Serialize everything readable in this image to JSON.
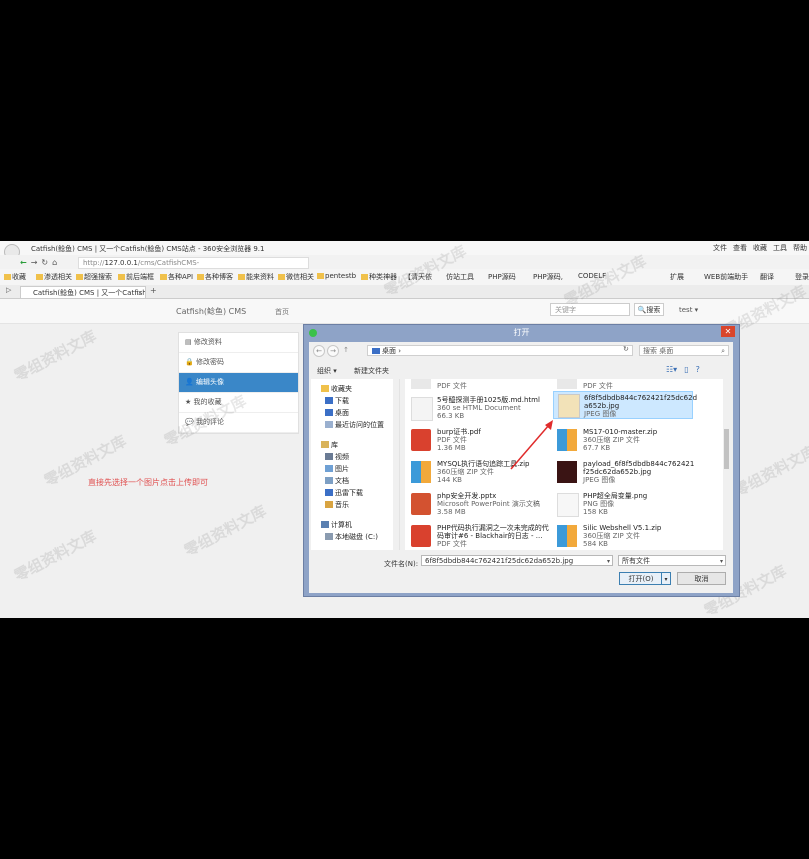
{
  "browser": {
    "window_title": "Catfish(鲶鱼) CMS | 又一个Catfish(鲶鱼) CMS站点 - 360安全浏览器 9.1",
    "menu": [
      "文件",
      "查看",
      "收藏",
      "工具",
      "帮助"
    ],
    "url_prefix": "http://",
    "url_host": "127.0.0.1",
    "url_path": "/cms/CatfishCMS-4.6.12/user/index/touxiang.html",
    "bookmarks": [
      "收藏",
      "渗透相关",
      "超强搜索",
      "前后端框",
      "各种API",
      "各种博客",
      "能来资料",
      "微信相关",
      "pentestb",
      "种类神器",
      "【清天依",
      "仿站工具",
      "PHP源码",
      "PHP源码,",
      "CODELF"
    ],
    "bookmarks_right": [
      "扩展",
      "WEB前端助手",
      "翻译",
      "登录"
    ],
    "tab_label": "Catfish(鲶鱼) CMS | 又一个Catfish",
    "tab_plus": "+"
  },
  "site": {
    "logo": "Catfish(鲶鱼) CMS",
    "home": "首页",
    "search_placeholder": "关键字",
    "search_button": "搜索",
    "user": "test",
    "sidebar": [
      "修改资料",
      "修改密码",
      "编辑头像",
      "我的收藏",
      "我的评论"
    ],
    "hint": "直接先选择一个图片点击上传即可"
  },
  "watermark": "零组资料文库",
  "dialog": {
    "title": "打开",
    "path": "桌面",
    "search_placeholder": "搜索 桌面",
    "organize": "组织",
    "new_folder": "新建文件夹",
    "tree": [
      "收藏夹",
      "下载",
      "桌面",
      "最近访问的位置",
      "库",
      "视频",
      "图片",
      "文档",
      "迅雷下载",
      "音乐",
      "计算机",
      "本地磁盘 (C:)"
    ],
    "files": [
      {
        "name": "",
        "type": "PDF 文件",
        "size": "",
        "icon": "pdf"
      },
      {
        "name": "",
        "type": "PDF 文件",
        "size": "",
        "icon": "pdf"
      },
      {
        "name": "5号醯探测手册1025版.md.html",
        "type": "360 se HTML Document",
        "size": "66.3 KB",
        "icon": "html"
      },
      {
        "name": "6f8f5dbdb844c762421f25dc62d a652b.jpg",
        "type": "JPEG 图像",
        "size": "",
        "icon": "image",
        "selected": true
      },
      {
        "name": "burp证书.pdf",
        "type": "PDF 文件",
        "size": "1.36 MB",
        "icon": "pdf"
      },
      {
        "name": "MS17-010-master.zip",
        "type": "360压缩 ZIP 文件",
        "size": "67.7 KB",
        "icon": "zip"
      },
      {
        "name": "MYSQL执行语句追踪工具.zip",
        "type": "360压缩 ZIP 文件",
        "size": "144 KB",
        "icon": "zip"
      },
      {
        "name": "payload_6f8f5dbdb844c762421 f25dc62da652b.jpg",
        "type": "JPEG 图像",
        "size": "",
        "icon": "dark"
      },
      {
        "name": "php安全开发.pptx",
        "type": "Microsoft PowerPoint 演示文稿",
        "size": "3.58 MB",
        "icon": "pptx"
      },
      {
        "name": "PHP超全局变量.png",
        "type": "PNG 图像",
        "size": "158 KB",
        "icon": "png"
      },
      {
        "name": "PHP代码执行漏洞之一次未完成的代码审计#6 - Blackhair的日志 - ...",
        "type": "PDF 文件",
        "size": "",
        "icon": "pdf"
      },
      {
        "name": "Silic Webshell V5.1.zip",
        "type": "360压缩 ZIP 文件",
        "size": "584 KB",
        "icon": "zip"
      }
    ],
    "filename_label": "文件名(N):",
    "filename_value": "6f8f5dbdb844c762421f25dc62da652b.jpg",
    "filetype_value": "所有文件",
    "open_button": "打开(O)",
    "cancel_button": "取消"
  },
  "colors": {
    "accent": "#3a87c8",
    "hint": "#e05050",
    "close": "#d9452c"
  }
}
